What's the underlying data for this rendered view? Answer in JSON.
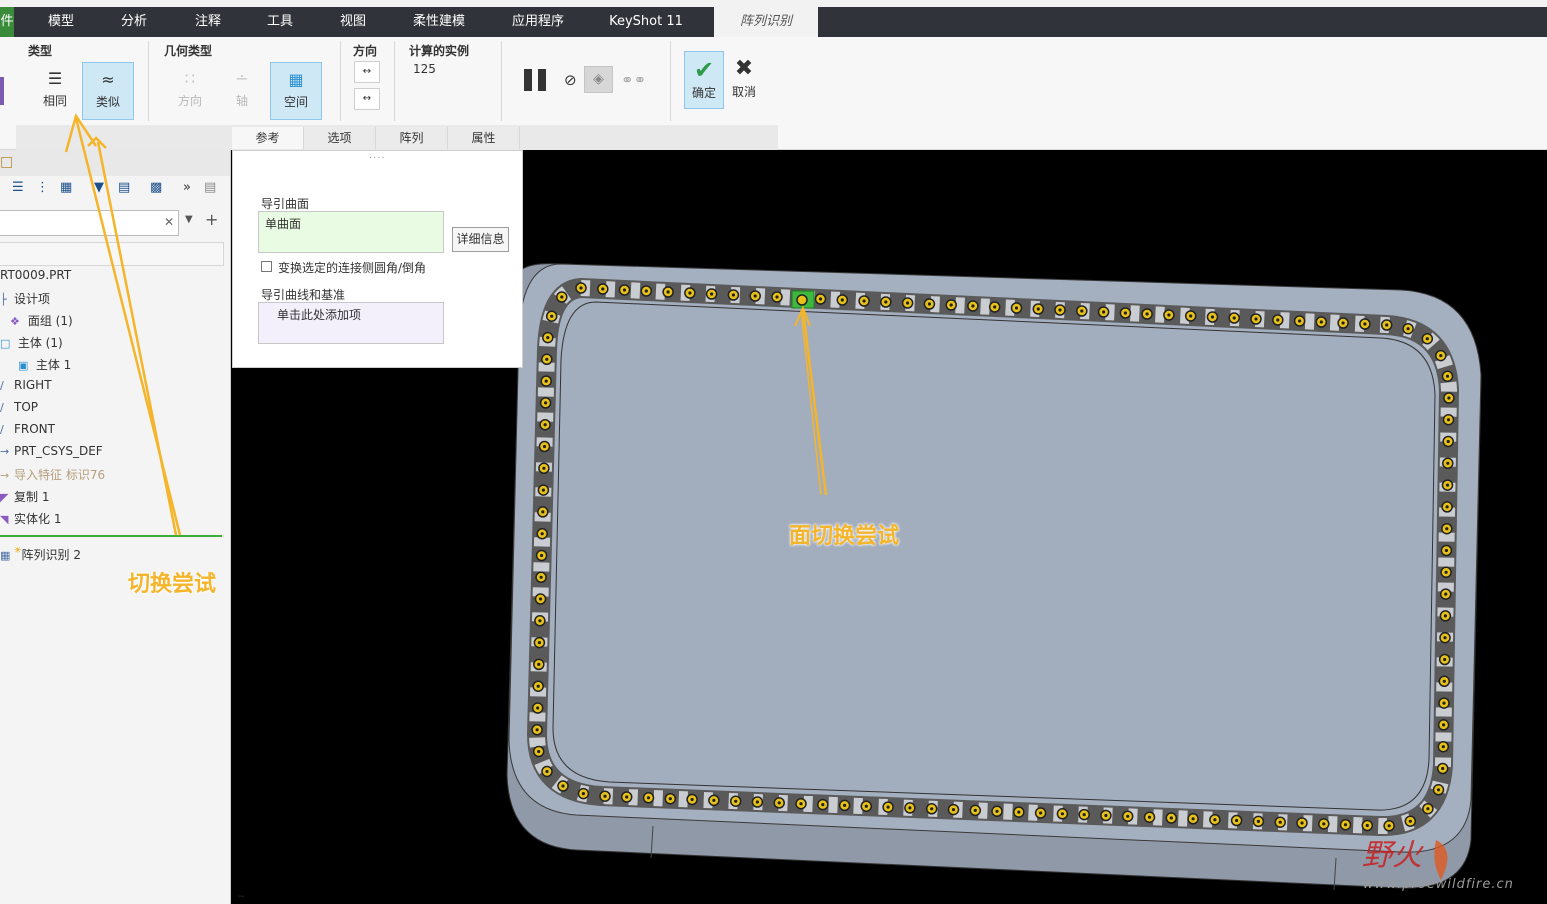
{
  "tabs": [
    {
      "label": "件",
      "file": true
    },
    {
      "label": "模型"
    },
    {
      "label": "分析"
    },
    {
      "label": "注释"
    },
    {
      "label": "工具"
    },
    {
      "label": "视图"
    },
    {
      "label": "柔性建模"
    },
    {
      "label": "应用程序"
    },
    {
      "label": "KeyShot 11"
    },
    {
      "label": "阵列识别",
      "active": true
    }
  ],
  "ribbon": {
    "type_group": {
      "title": "类型",
      "same": "相同",
      "similar": "类似"
    },
    "geom_group": {
      "title": "几何类型",
      "direction": "方向",
      "axis": "轴",
      "space": "空间"
    },
    "dir_group": {
      "title": "方向"
    },
    "calc_group": {
      "title": "计算的实例",
      "value": "125"
    },
    "confirm": "确定",
    "cancel": "取消",
    "subtabs": [
      "参考",
      "选项",
      "阵列",
      "属性"
    ]
  },
  "tree": {
    "items": [
      {
        "label": "RT0009.PRT"
      },
      {
        "label": "设计项"
      },
      {
        "label": "面组 (1)"
      },
      {
        "label": "主体 (1)"
      },
      {
        "label": "主体 1"
      },
      {
        "label": "RIGHT"
      },
      {
        "label": "TOP"
      },
      {
        "label": "FRONT"
      },
      {
        "label": "PRT_CSYS_DEF"
      },
      {
        "label": "导入特征 标识76",
        "dim": true
      },
      {
        "label": "复制 1"
      },
      {
        "label": "实体化 1"
      },
      {
        "label": "阵列识别 2"
      }
    ]
  },
  "refpanel": {
    "guide_surface_label": "导引曲面",
    "guide_surface_value": "单曲面",
    "detail_button": "详细信息",
    "checkbox_label": "变换选定的连接侧圆角/倒角",
    "guide_curves_label": "导引曲线和基准",
    "guide_curves_placeholder": "单击此处添加项"
  },
  "annotations": {
    "left": "切换尝试",
    "center": "面切换尝试"
  },
  "watermark": {
    "logo_text": "野火",
    "url": "www.proewildfire.cn"
  },
  "colors": {
    "accent_orange": "#f5b52a",
    "selection_blue": "#cfe8f6",
    "confirm_green": "#2e9a4a",
    "part_face": "#a0acbc",
    "hole_yellow": "#e8c21a"
  }
}
